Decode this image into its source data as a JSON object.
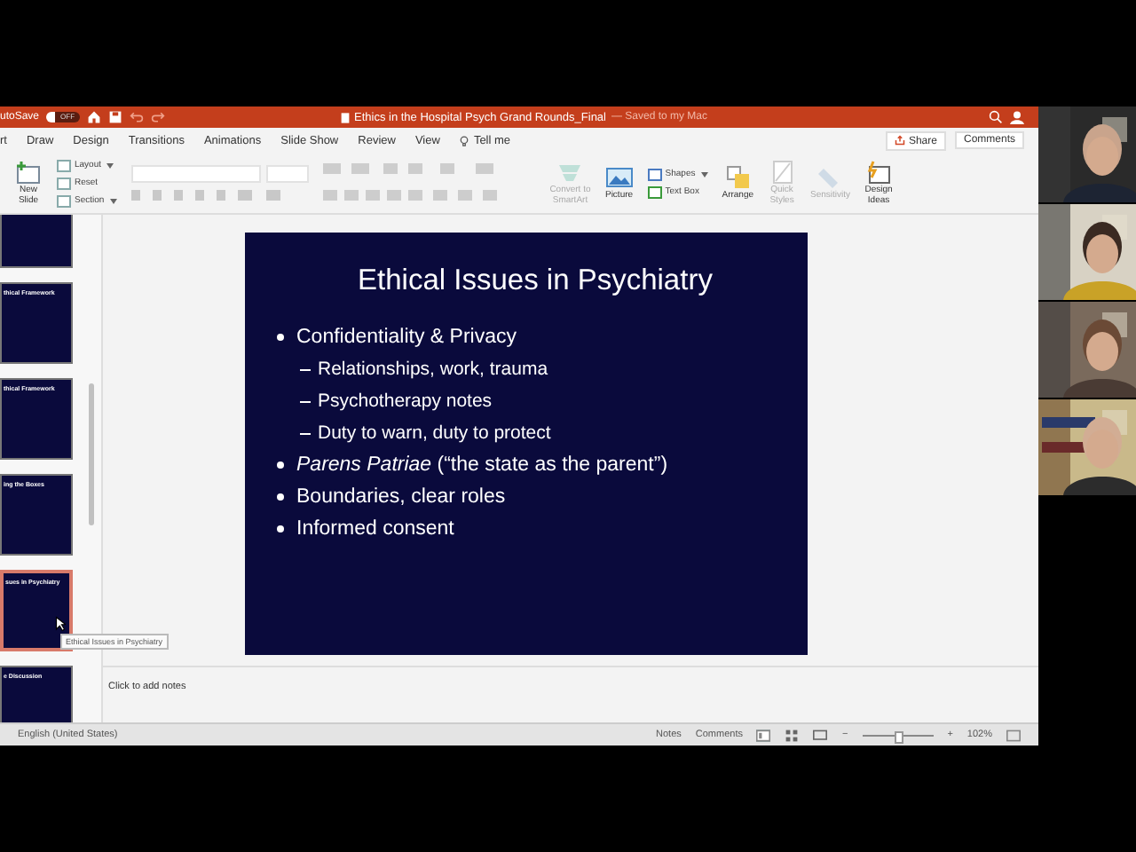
{
  "title_bar": {
    "autosave_label": "utoSave",
    "autosave_state": "OFF",
    "document_title": "Ethics in the Hospital Psych Grand Rounds_Final",
    "save_status": "— Saved to my Mac"
  },
  "ribbon_tabs": [
    {
      "label": "rt",
      "selected": false
    },
    {
      "label": "Draw",
      "selected": false
    },
    {
      "label": "Design",
      "selected": false
    },
    {
      "label": "Transitions",
      "selected": false
    },
    {
      "label": "Animations",
      "selected": false
    },
    {
      "label": "Slide Show",
      "selected": false
    },
    {
      "label": "Review",
      "selected": false
    },
    {
      "label": "View",
      "selected": false
    }
  ],
  "tell_me": "Tell me",
  "share": "Share",
  "comments_button": "Comments",
  "ribbon": {
    "new_slide": "New\nSlide",
    "layout": "Layout",
    "reset": "Reset",
    "section": "Section",
    "convert": "Convert to\nSmartArt",
    "picture": "Picture",
    "shapes": "Shapes",
    "text_box": "Text Box",
    "arrange": "Arrange",
    "quick_styles": "Quick\nStyles",
    "sensitivity": "Sensitivity",
    "design_ideas": "Design\nIdeas"
  },
  "thumbnails": [
    {
      "selected": false
    },
    {
      "title": "thical Framework",
      "selected": false
    },
    {
      "title": "thical Framework",
      "selected": false
    },
    {
      "title": "ing the Boxes",
      "selected": false
    },
    {
      "title": "sues in Psychiatry",
      "selected": true
    },
    {
      "title": "e Discussion",
      "selected": false
    }
  ],
  "tooltip": "Ethical Issues in Psychiatry",
  "slide": {
    "title": "Ethical Issues in Psychiatry",
    "bullets": [
      {
        "text": "Confidentiality & Privacy",
        "children": [
          {
            "text": "Relationships, work, trauma"
          },
          {
            "text": "Psychotherapy notes"
          },
          {
            "text": "Duty to warn, duty to protect"
          }
        ]
      },
      {
        "text": "*Parens Patriae* (“the state as the parent”)"
      },
      {
        "text": "Boundaries, clear roles"
      },
      {
        "text": "Informed consent"
      }
    ]
  },
  "notes_placeholder": "Click to add notes",
  "status_bar": {
    "language": "English (United States)",
    "notes": "Notes",
    "comments": "Comments",
    "zoom_out": "−",
    "zoom": {
      "level": 0.5
    },
    "zoom_in": "+",
    "zoom_percent": "102%"
  }
}
